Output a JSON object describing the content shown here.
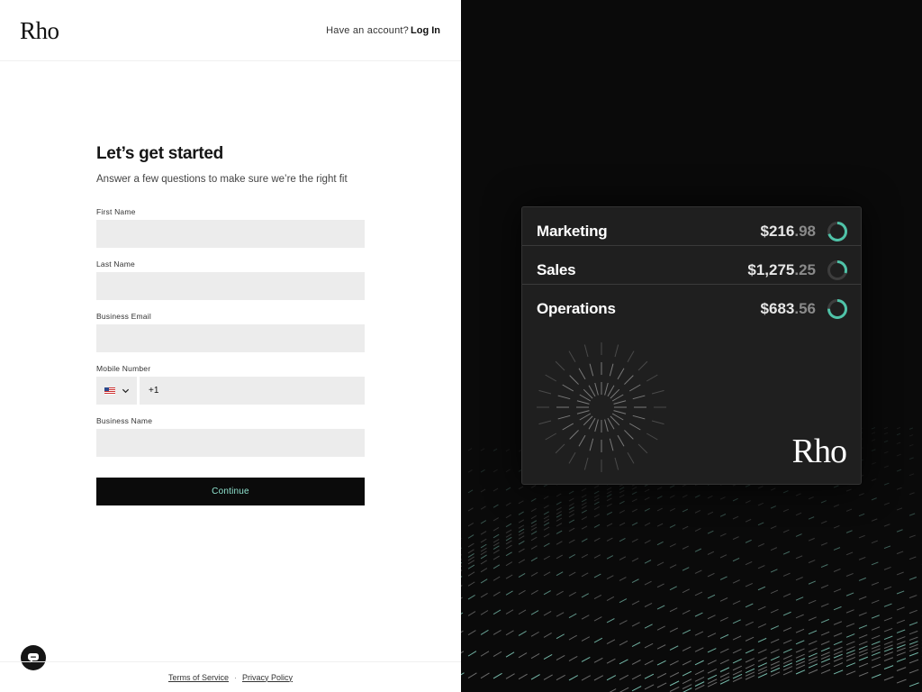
{
  "header": {
    "logo": "Rho",
    "have_account": "Have an account?",
    "login": "Log In"
  },
  "form": {
    "title": "Let’s get started",
    "subtitle": "Answer a few questions to make sure we’re the right fit",
    "fields": {
      "first_name": {
        "label": "First Name",
        "value": ""
      },
      "last_name": {
        "label": "Last Name",
        "value": ""
      },
      "business_email": {
        "label": "Business Email",
        "value": ""
      },
      "mobile_number": {
        "label": "Mobile Number",
        "country_code": "+1",
        "country_icon": "us-flag-icon"
      },
      "business_name": {
        "label": "Business Name",
        "value": ""
      }
    },
    "continue_label": "Continue"
  },
  "footer": {
    "terms": "Terms of Service",
    "separator": "·",
    "privacy": "Privacy Policy"
  },
  "card": {
    "rows": [
      {
        "name": "Marketing",
        "amount_main": "$216",
        "amount_cents": ".98",
        "progress": 0.7
      },
      {
        "name": "Sales",
        "amount_main": "$1,275",
        "amount_cents": ".25",
        "progress": 0.3
      },
      {
        "name": "Operations",
        "amount_main": "$683",
        "amount_cents": ".56",
        "progress": 0.75
      }
    ],
    "logo": "Rho"
  },
  "colors": {
    "accent": "#8fe3cf",
    "ring_accent": "#4fc3a8",
    "panel_dark": "#0a0a0a"
  }
}
